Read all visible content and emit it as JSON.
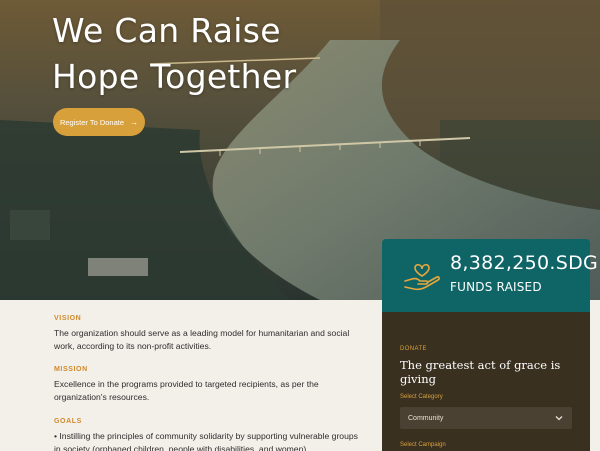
{
  "hero": {
    "title": "We Can Raise Hope Together",
    "cta_label": "Register To Donate",
    "cta_arrow": "→"
  },
  "sections": [
    {
      "label": "VISION",
      "text": "The organization should serve as a leading model for humanitarian and social work, according to its non-profit activities."
    },
    {
      "label": "MISSION",
      "text": "Excellence in the programs provided to targeted recipients, as per the organization's resources."
    },
    {
      "label": "GOALS",
      "text": "• Instilling the principles of community solidarity by supporting vulnerable groups in society (orphaned children, people with disabilities, and women)."
    }
  ],
  "funds": {
    "amount": "8,382,250.SDG",
    "label": "FUNDS RAISED",
    "icon": "heart-hand-icon"
  },
  "donate": {
    "eyebrow": "DONATE",
    "title": "The greatest act of grace is giving",
    "category_label": "Select Category",
    "category_value": "Community",
    "campaign_label": "Select Campaign"
  },
  "colors": {
    "accent": "#d8a03a",
    "teal": "#0f6466",
    "form_bg": "#3a3020"
  }
}
